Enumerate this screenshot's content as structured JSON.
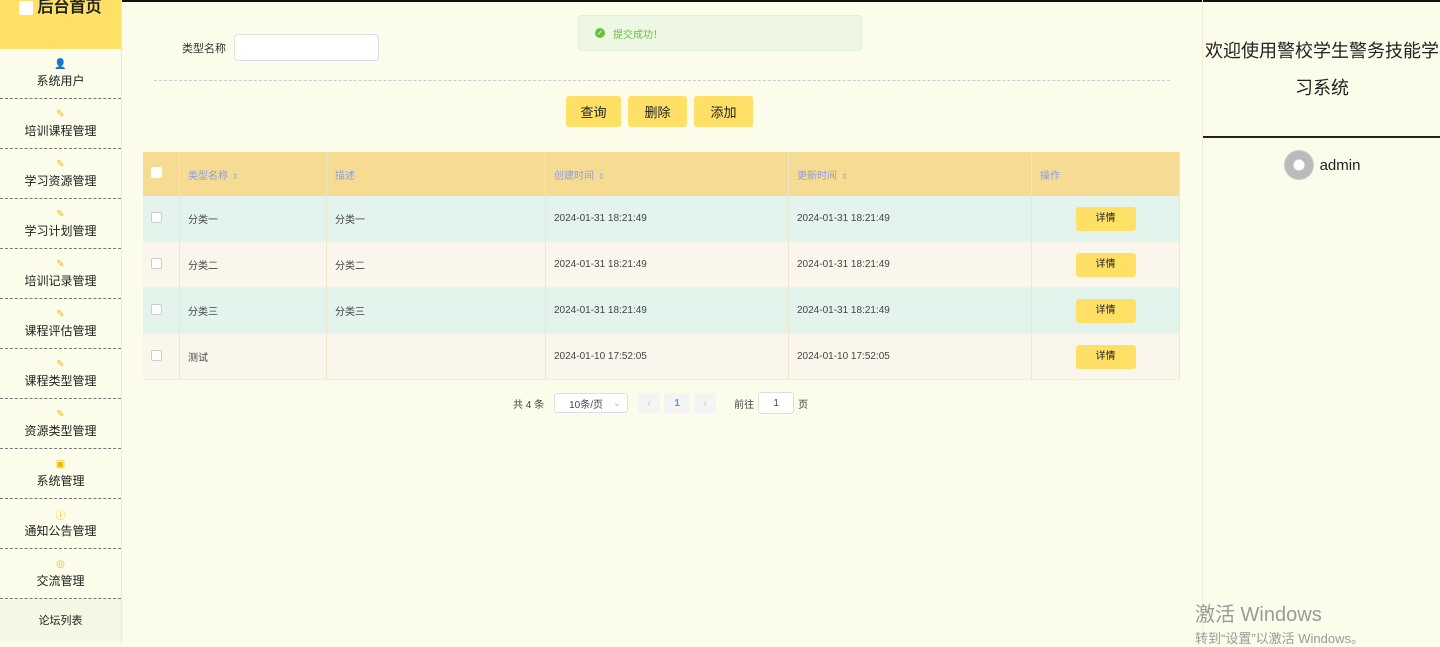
{
  "sidebar": {
    "title": "后台首页",
    "items": [
      {
        "label": "系统用户",
        "icon": "user-icon"
      },
      {
        "label": "培训课程管理",
        "icon": "edit-icon"
      },
      {
        "label": "学习资源管理",
        "icon": "edit-icon"
      },
      {
        "label": "学习计划管理",
        "icon": "edit-icon"
      },
      {
        "label": "培训记录管理",
        "icon": "edit-icon"
      },
      {
        "label": "课程评估管理",
        "icon": "edit-icon"
      },
      {
        "label": "课程类型管理",
        "icon": "edit-icon"
      },
      {
        "label": "资源类型管理",
        "icon": "edit-icon"
      },
      {
        "label": "系统管理",
        "icon": "picture-icon"
      },
      {
        "label": "通知公告管理",
        "icon": "info-icon"
      },
      {
        "label": "交流管理",
        "icon": "chat-icon"
      }
    ],
    "sub_item": "论坛列表"
  },
  "search": {
    "label": "类型名称",
    "value": ""
  },
  "toast": {
    "text": "提交成功！"
  },
  "buttons": {
    "query": "查询",
    "delete": "删除",
    "add": "添加"
  },
  "table": {
    "headers": [
      "类型名称",
      "描述",
      "创建时间",
      "更新时间",
      "操作"
    ],
    "rows": [
      {
        "name": "分类一",
        "desc": "分类一",
        "created": "2024-01-31 18:21:49",
        "updated": "2024-01-31 18:21:49",
        "action": "详情"
      },
      {
        "name": "分类二",
        "desc": "分类二",
        "created": "2024-01-31 18:21:49",
        "updated": "2024-01-31 18:21:49",
        "action": "详情"
      },
      {
        "name": "分类三",
        "desc": "分类三",
        "created": "2024-01-31 18:21:49",
        "updated": "2024-01-31 18:21:49",
        "action": "详情"
      },
      {
        "name": "测试",
        "desc": "",
        "created": "2024-01-10 17:52:05",
        "updated": "2024-01-10 17:52:05",
        "action": "详情"
      }
    ]
  },
  "pager": {
    "total": "共 4 条",
    "size": "10条/页",
    "current": "1",
    "goto_prefix": "前往",
    "goto_value": "1",
    "goto_suffix": "页"
  },
  "right": {
    "welcome_line1": "欢迎使用警校学生警务技能学",
    "welcome_line2": "习系统",
    "username": "admin"
  },
  "watermark": {
    "line1": "激活 Windows",
    "line2": "转到“设置”以激活 Windows。"
  },
  "colors": {
    "accent": "#ffe066",
    "header_bg": "#f6dc92",
    "page_bg": "#fbfce9"
  }
}
